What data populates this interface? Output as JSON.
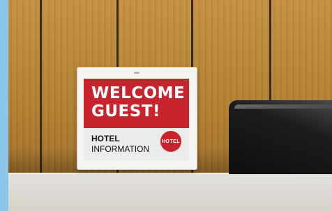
{
  "sign": {
    "headline_line1": "WELCOME",
    "headline_line2": "GUEST!",
    "info_title": "HOTEL",
    "info_subtitle": "INFORMATION",
    "badge_text": "HOTEL"
  },
  "colors": {
    "banner_red": "#c8242e",
    "wall_wood": "#b3802f",
    "counter_stone": "#dcdad4",
    "left_stripe": "#8cc4ea",
    "monitor": "#1c1c1c"
  }
}
